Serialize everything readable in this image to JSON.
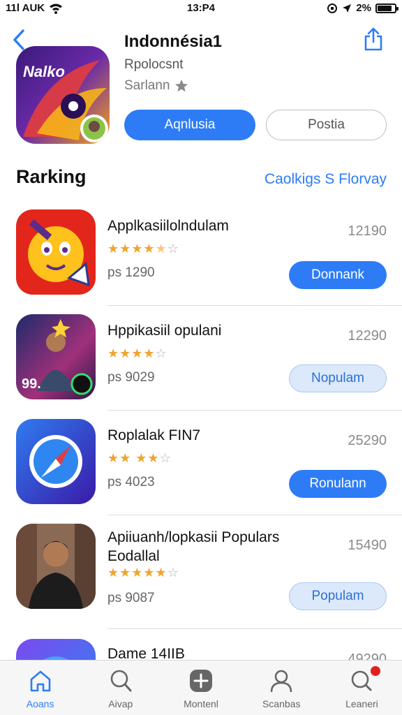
{
  "status": {
    "carrier": "11l AUK",
    "time": "13:P4",
    "battery": "2%"
  },
  "header": {
    "back_icon": "chevron-left-icon",
    "share_icon": "share-icon",
    "app_name": "Indonnésia1",
    "subtitle": "Rpolocsnt",
    "rating_text": "Sarlann",
    "primary_button": "Aqnlusia",
    "secondary_button": "Postia"
  },
  "section": {
    "title": "Rarking",
    "link": "Caolkigs  S Florvay"
  },
  "apps": [
    {
      "name": "Applkasiilolndulam",
      "stars": 4.5,
      "meta": "ps 1290",
      "count": "12190",
      "button": "Donnank",
      "style": "solid"
    },
    {
      "name": "Hppikasiil opulani",
      "stars": 4,
      "meta": "ps 9029",
      "count": "12290",
      "button": "Nopulam",
      "style": "soft"
    },
    {
      "name": "Roplalak FIN7",
      "stars": 3.5,
      "meta": "ps 4023",
      "count": "25290",
      "button": "Ronulann",
      "style": "solid"
    },
    {
      "name": "Apiiuanh/lopkasii Populars Eodallal",
      "stars": 4.5,
      "meta": "ps 9087",
      "count": "15490",
      "button": "Populam",
      "style": "soft"
    },
    {
      "name": "Dame 14IIB",
      "stars": 0,
      "meta": "",
      "count": "49290",
      "button": "",
      "style": "solid"
    }
  ],
  "tabs": [
    {
      "label": "Aoans",
      "icon": "home-icon",
      "active": true
    },
    {
      "label": "Aivap",
      "icon": "search-icon",
      "active": false
    },
    {
      "label": "Montenl",
      "icon": "plus-square-icon",
      "active": false
    },
    {
      "label": "Scanbas",
      "icon": "person-icon",
      "active": false
    },
    {
      "label": "Leaneri",
      "icon": "search-bell-icon",
      "active": false,
      "badge": true
    }
  ],
  "colors": {
    "accent": "#2d7cf6",
    "star": "#f2a32c",
    "badge": "#e02020"
  }
}
